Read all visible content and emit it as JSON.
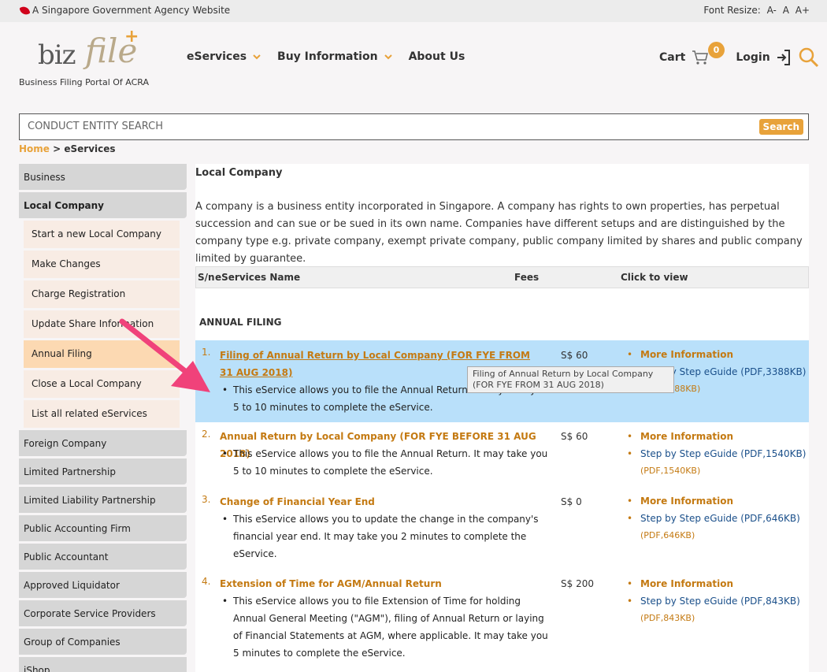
{
  "topbar": {
    "gov_text": "A Singapore Government Agency Website",
    "font_resize_label": "Font Resize:",
    "font_sizes": [
      "A-",
      "A",
      "A+"
    ]
  },
  "header": {
    "logo_biz": "biz",
    "logo_file": "file",
    "logo_plus": "+",
    "tagline": "Business Filing Portal Of ACRA",
    "nav": [
      {
        "label": "eServices",
        "has_dropdown": true
      },
      {
        "label": "Buy Information",
        "has_dropdown": true
      },
      {
        "label": "About Us",
        "has_dropdown": false
      }
    ],
    "cart_label": "Cart",
    "cart_count": "0",
    "login_label": "Login"
  },
  "search": {
    "placeholder": "CONDUCT ENTITY SEARCH",
    "button_label": "Search"
  },
  "breadcrumb": {
    "home": "Home",
    "separator": ">",
    "current": "eServices"
  },
  "sidebar": {
    "items": [
      {
        "label": "Business",
        "type": "main"
      },
      {
        "label": "Local Company",
        "type": "main",
        "active": true
      },
      {
        "label": "Start a new Local Company",
        "type": "sub"
      },
      {
        "label": "Make Changes",
        "type": "sub"
      },
      {
        "label": "Charge Registration",
        "type": "sub"
      },
      {
        "label": "Update Share Information",
        "type": "sub"
      },
      {
        "label": "Annual Filing",
        "type": "sub",
        "active": true
      },
      {
        "label": "Close a Local Company",
        "type": "sub"
      },
      {
        "label": "List all related eServices",
        "type": "sub"
      },
      {
        "label": "Foreign Company",
        "type": "main"
      },
      {
        "label": "Limited Partnership",
        "type": "main"
      },
      {
        "label": "Limited Liability Partnership",
        "type": "main"
      },
      {
        "label": "Public Accounting Firm",
        "type": "main"
      },
      {
        "label": "Public Accountant",
        "type": "main"
      },
      {
        "label": "Approved Liquidator",
        "type": "main"
      },
      {
        "label": "Corporate Service Providers",
        "type": "main"
      },
      {
        "label": "Group of Companies",
        "type": "main"
      },
      {
        "label": "iShop",
        "type": "main"
      }
    ]
  },
  "content": {
    "heading": "Local Company",
    "intro": "A company is a business entity incorporated in Singapore. A company has rights to own properties, has perpetual succession and can sue or be sued in its own name. Companies have different setups and are distinguished by the company type e.g. private company, exempt private company, public company limited by shares and public company limited by guarantee.",
    "table_headers": {
      "sn": "S/n",
      "name": "eServices Name",
      "fees": "Fees",
      "view": "Click to view"
    },
    "section_title": "ANNUAL FILING",
    "rows": [
      {
        "num": "1.",
        "title": "Filing of Annual Return by Local Company (FOR FYE FROM 31 AUG 2018)",
        "desc": "This eService allows you to file the Annual Return. It may take you 5 to 10 minutes to complete the eService.",
        "fee": "S$ 60",
        "more_info": "More Information",
        "guide": "Step by Step eGuide (PDF,3388KB)",
        "guide_size": "(PDF,3388KB)",
        "highlighted": true
      },
      {
        "num": "2.",
        "title": "Annual Return by Local Company (FOR FYE BEFORE 31 AUG 2018)",
        "desc": "This eService allows you to file the Annual Return. It may take you 5 to 10 minutes to complete the eService.",
        "fee": "S$ 60",
        "more_info": "More Information",
        "guide": "Step by Step eGuide (PDF,1540KB)",
        "guide_size": "(PDF,1540KB)"
      },
      {
        "num": "3.",
        "title": "Change of Financial Year End",
        "desc": "This eService allows you to update the change in the company's financial year end. It may take you 2 minutes to complete the eService.",
        "fee": "S$ 0",
        "more_info": "More Information",
        "guide": "Step by Step eGuide (PDF,646KB)",
        "guide_size": "(PDF,646KB)"
      },
      {
        "num": "4.",
        "title": "Extension of Time for AGM/Annual Return",
        "desc": "This eService allows you to file Extension of Time for holding Annual General Meeting (\"AGM\"), filing of Annual Return or laying of Financial Statements at AGM, where applicable. It may take you 5 minutes to complete the eService.",
        "fee": "S$ 200",
        "more_info": "More Information",
        "guide": "Step by Step eGuide (PDF,843KB)",
        "guide_size": "(PDF,843KB)"
      }
    ],
    "tooltip": "Filing of Annual Return by Local Company (FOR FYE FROM 31 AUG 2018)"
  },
  "colors": {
    "accent": "#e8a23a",
    "link_orange": "#c47a12",
    "link_blue": "#1a4f8a",
    "highlight_row": "#b9e0fa",
    "annotation_arrow": "#f0427a"
  }
}
